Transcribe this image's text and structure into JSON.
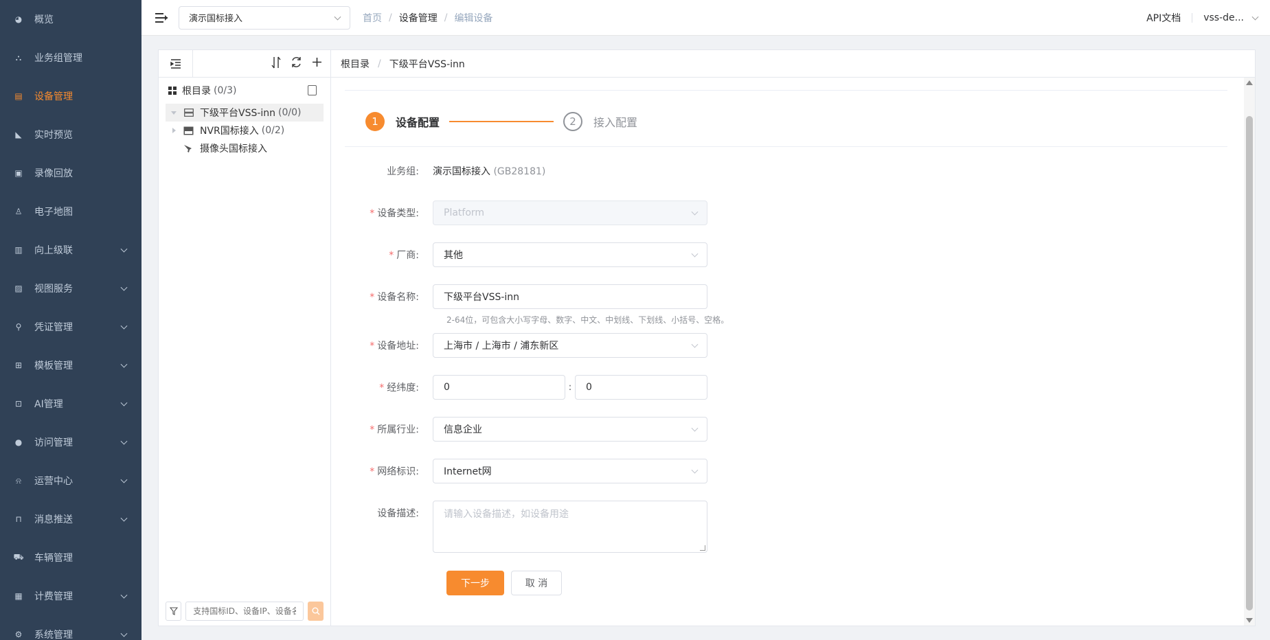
{
  "sidebar": {
    "items": [
      {
        "label": "概览",
        "icon": "dashboard-icon",
        "has_children": false,
        "active": false
      },
      {
        "label": "业务组管理",
        "icon": "org-icon",
        "has_children": false,
        "active": false
      },
      {
        "label": "设备管理",
        "icon": "device-icon",
        "has_children": false,
        "active": true
      },
      {
        "label": "实时预览",
        "icon": "camera-icon",
        "has_children": false,
        "active": false
      },
      {
        "label": "录像回放",
        "icon": "video-icon",
        "has_children": false,
        "active": false
      },
      {
        "label": "电子地图",
        "icon": "map-pin-icon",
        "has_children": false,
        "active": false
      },
      {
        "label": "向上级联",
        "icon": "cascade-icon",
        "has_children": true,
        "active": false
      },
      {
        "label": "视图服务",
        "icon": "image-icon",
        "has_children": true,
        "active": false
      },
      {
        "label": "凭证管理",
        "icon": "key-icon",
        "has_children": true,
        "active": false
      },
      {
        "label": "模板管理",
        "icon": "grid-icon",
        "has_children": true,
        "active": false
      },
      {
        "label": "AI管理",
        "icon": "ai-icon",
        "has_children": true,
        "active": false
      },
      {
        "label": "访问管理",
        "icon": "user-icon",
        "has_children": true,
        "active": false
      },
      {
        "label": "运营中心",
        "icon": "bell-icon",
        "has_children": true,
        "active": false
      },
      {
        "label": "消息推送",
        "icon": "inbox-icon",
        "has_children": true,
        "active": false
      },
      {
        "label": "车辆管理",
        "icon": "car-icon",
        "has_children": false,
        "active": false
      },
      {
        "label": "计费管理",
        "icon": "billing-icon",
        "has_children": true,
        "active": false
      },
      {
        "label": "系统管理",
        "icon": "settings-icon",
        "has_children": true,
        "active": false
      }
    ]
  },
  "navbar": {
    "group_select": "演示国标接入",
    "breadcrumb": [
      "首页",
      "设备管理",
      "编辑设备"
    ],
    "api_docs": "API文档",
    "user": "vss-de..."
  },
  "tree": {
    "root_label": "根目录",
    "root_count": "(0/3)",
    "nodes": [
      {
        "label": "下级平台VSS-inn",
        "count": "(0/0)",
        "icon": "server-icon",
        "expander": "down",
        "selected": true
      },
      {
        "label": "NVR国标接入",
        "count": "(0/2)",
        "icon": "nvr-icon",
        "expander": "right",
        "selected": false
      },
      {
        "label": "摄像头国标接入",
        "count": "",
        "icon": "camera-icon",
        "expander": "none",
        "selected": false
      }
    ],
    "search_placeholder": "支持国标ID、设备IP、设备名称"
  },
  "form_header": {
    "breadcrumb": [
      "根目录",
      "下级平台VSS-inn"
    ]
  },
  "steps": [
    {
      "num": "1",
      "title": "设备配置",
      "active": true
    },
    {
      "num": "2",
      "title": "接入配置",
      "active": false
    }
  ],
  "form": {
    "business_group": {
      "label": "业务组:",
      "value": "演示国标接入",
      "code": "(GB28181)"
    },
    "device_type": {
      "label": "设备类型:",
      "value": "Platform",
      "required": "*"
    },
    "vendor": {
      "label": "厂商:",
      "value": "其他",
      "required": "*"
    },
    "device_name": {
      "label": "设备名称:",
      "value": "下级平台VSS-inn",
      "required": "*",
      "hint": "2-64位，可包含大小写字母、数字、中文、中划线、下划线、小括号、空格。"
    },
    "address": {
      "label": "设备地址:",
      "value": "上海市 / 上海市 / 浦东新区",
      "required": "*"
    },
    "coords": {
      "label": "经纬度:",
      "lng": "0",
      "lat": "0",
      "sep": ":",
      "required": "*"
    },
    "industry": {
      "label": "所属行业:",
      "value": "信息企业",
      "required": "*"
    },
    "network": {
      "label": "网络标识:",
      "value": "Internet网",
      "required": "*"
    },
    "description": {
      "label": "设备描述:",
      "placeholder": "请输入设备描述，如设备用途"
    },
    "next_button": "下一步",
    "cancel_button": "取 消"
  },
  "colors": {
    "sidebar_bg": "#304156",
    "accent": "#f78b2f",
    "required": "#f56c6c"
  }
}
